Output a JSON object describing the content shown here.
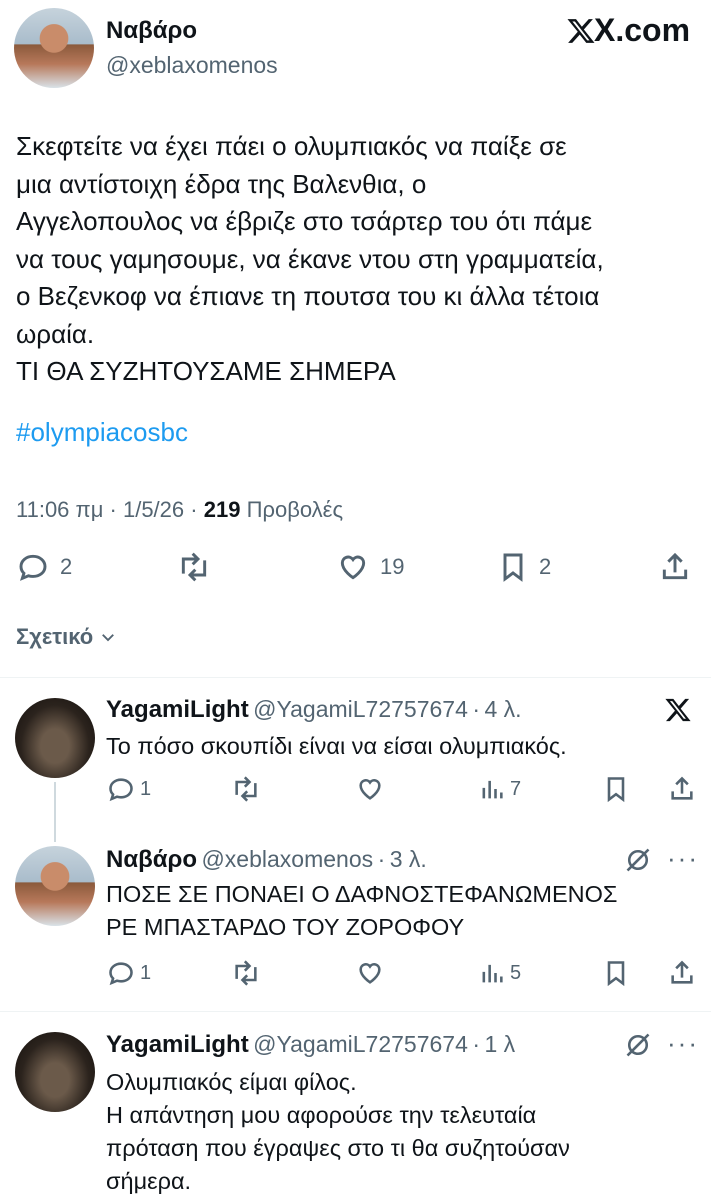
{
  "main_tweet": {
    "author_name": "Ναβάρο",
    "author_handle": "@xeblaxomenos",
    "brand": "X.com",
    "text": "Σκεφτείτε να έχει πάει ο ολυμπιακός να παίξε σε\nμια αντίστοιχη έδρα της Βαλενθια, ο\nΑγγελοπουλος να έβριζε στο τσάρτερ του ότι πάμε\nνα τους γαμησουμε, να έκανε ντου στη γραμματεία,\nο Βεζενκοφ να έπιανε τη πουτσα του κι άλλα τέτοια\nωραία.\nΤΙ ΘΑ ΣΥΖΗΤΟΥΣΑΜΕ ΣΗΜΕΡΑ",
    "hashtag": "#olympiacosbc",
    "time": "11:06 πμ",
    "date": "1/5/26",
    "views_count": "219",
    "views_label": "Προβολές",
    "replies": "2",
    "likes": "19",
    "bookmarks": "2",
    "related_label": "Σχετικό"
  },
  "replies": [
    {
      "name": "YagamiLight",
      "handle": "@YagamiL72757674",
      "age": "4 λ.",
      "text": "Το πόσο σκουπίδι είναι να είσαι ολυμπιακός.",
      "replies": "1",
      "views": "7"
    },
    {
      "name": "Ναβάρο",
      "handle": "@xeblaxomenos",
      "age": "3 λ.",
      "text": "ΠΟΣΕ ΣΕ ΠΟΝΑΕΙ Ο ΔΑΦΝΟΣΤΕΦΑΝΩΜΕΝΟΣ\nΡΕ ΜΠΑΣΤΑΡΔΟ ΤΟΥ ΖΟΡΟΦΟΥ",
      "replies": "1",
      "views": "5"
    },
    {
      "name": "YagamiLight",
      "handle": "@YagamiL72757674",
      "age": "1 λ",
      "text": "Ολυμπιακός είμαι φίλος.\nΗ απάντηση μου αφορούσε την τελευταία\nπρόταση που έγραψες στο τι θα συζητούσαν\nσήμερα."
    }
  ],
  "separator": "·"
}
